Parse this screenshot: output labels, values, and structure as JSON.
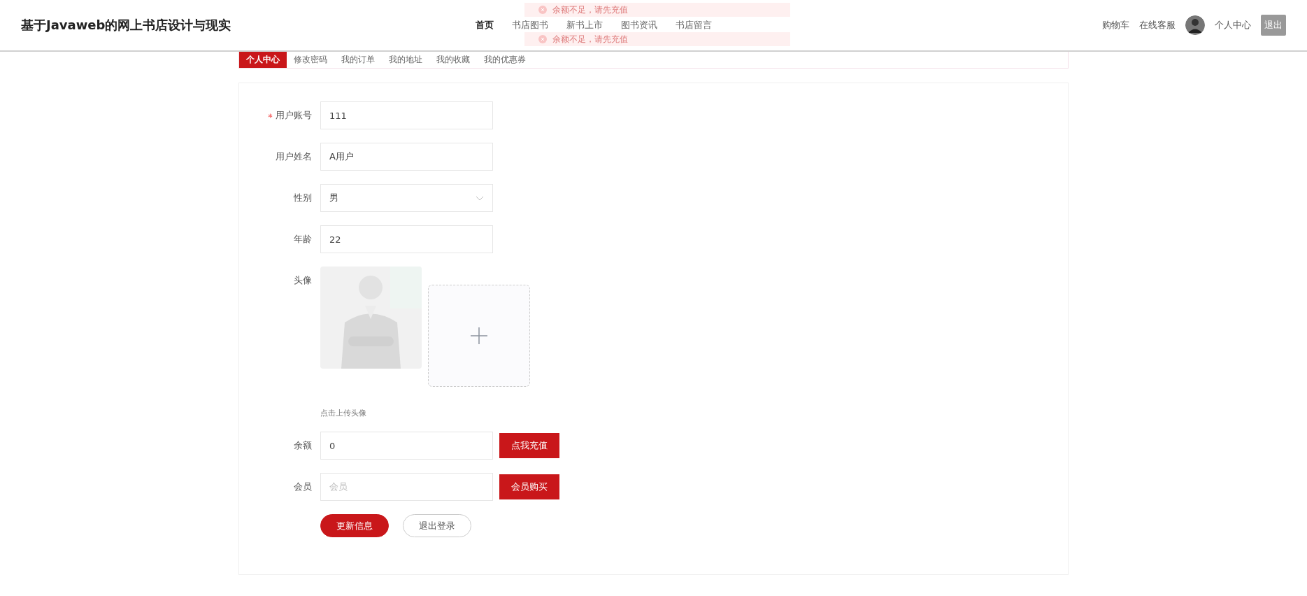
{
  "header": {
    "title": "基于Javaweb的网上书店设计与现实",
    "nav": [
      {
        "label": "首页",
        "selected": true
      },
      {
        "label": "书店图书",
        "selected": false
      },
      {
        "label": "新书上市",
        "selected": false
      },
      {
        "label": "图书资讯",
        "selected": false
      },
      {
        "label": "书店留言",
        "selected": false
      }
    ],
    "right_links": [
      "购物车",
      "在线客服"
    ],
    "user_link": "个人中心",
    "logout": "退出"
  },
  "toasts": [
    "余额不足，请先充值",
    "余额不足，请先充值"
  ],
  "tabs": [
    {
      "label": "个人中心",
      "selected": true
    },
    {
      "label": "修改密码",
      "selected": false
    },
    {
      "label": "我的订单",
      "selected": false
    },
    {
      "label": "我的地址",
      "selected": false
    },
    {
      "label": "我的收藏",
      "selected": false
    },
    {
      "label": "我的优惠券",
      "selected": false
    }
  ],
  "form": {
    "fields": [
      {
        "kind": "input",
        "label": "用户账号",
        "required": true,
        "value": "111"
      },
      {
        "kind": "input",
        "label": "用户姓名",
        "required": false,
        "value": "A用户"
      },
      {
        "kind": "select",
        "label": "性别",
        "required": false,
        "value": "男"
      },
      {
        "kind": "input",
        "label": "年龄",
        "required": false,
        "value": "22"
      },
      {
        "kind": "avatar",
        "label": "头像",
        "required": false,
        "hint": "点击上传头像"
      },
      {
        "kind": "action",
        "label": "余额",
        "required": false,
        "value": "0",
        "button": "点我充值"
      },
      {
        "kind": "action",
        "label": "会员",
        "required": false,
        "placeholder": "会员",
        "button": "会员购买"
      }
    ],
    "buttons": [
      {
        "label": "更新信息",
        "kind": "primary"
      },
      {
        "label": "退出登录",
        "kind": "plain"
      }
    ]
  }
}
